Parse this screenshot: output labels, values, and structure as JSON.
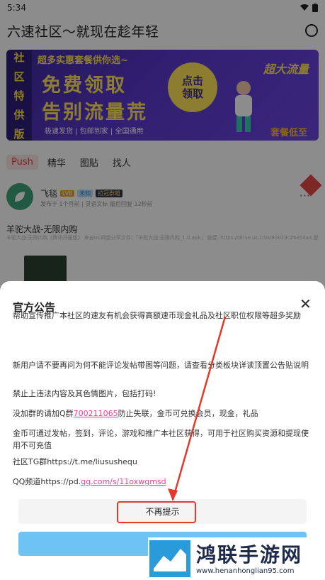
{
  "status_bar": {
    "time": "5:34"
  },
  "header": {
    "title": "六速社区～就现在趁年轻"
  },
  "banner": {
    "side_chars": [
      "社",
      "区",
      "特",
      "供",
      "版"
    ],
    "promo_line": "超多实惠套餐供你选~",
    "big_line_1": "免费领取",
    "big_line_2": "告别流量荒",
    "bottom_line": "极速发货 | 包邮到家 | 全国通用",
    "claim_line_1": "点击",
    "claim_line_2": "领取",
    "right_tag": "超大流量",
    "right_bottom": "套餐低至"
  },
  "tabs": [
    {
      "label": "Push",
      "active": true
    },
    {
      "label": "精华",
      "active": false
    },
    {
      "label": "图贴",
      "active": false
    },
    {
      "label": "找人",
      "active": false
    }
  ],
  "post": {
    "author": "飞毯",
    "level_badge": "LV8",
    "badge_2": "未知",
    "badge_3": "拉冠群雄",
    "meta": "发布于 1个月前 | 灵语文标 最后回复 12秒前",
    "title": "羊驼大战-无限内购",
    "snippet": "羊驼大战-无限内购《腾讯开服版》 来自UC网盘分享文件：「羊驼大战-无限内购_1.0.apk」 链接: https://drive.uc.cn/s/83023c26e54a4 提取码: 168FUC 网盘一上传下载不限速，网速有多快，速度就有多快。 ?"
  },
  "dialog": {
    "title": "官方公告",
    "p1": "帮助宣传推广本社区的速友有机会获得高额速币现金礼品及社区职位权限等超多奖励",
    "p2": "新用户请不要再问为何不能评论发帖带图等问题，请查看分类板块详读顶置公告贴说明",
    "p3": "禁止上违法内容及其色情图片，包括打码!",
    "p4_before": "没加群的请加Q群",
    "p4_link": "700211065",
    "p4_after": "防止失联，金币可兑换会员，现金，礼品",
    "p5": "金币可通过发帖，签到，评论，游戏和推广本社区获得，可用于社区购买资源和提现使用不可充值",
    "p6": "社区TG群https://t.me/liusushequ",
    "p7_before": "QQ频道https://pd.",
    "p7_link": "qq.com/s/11oxwgmsd",
    "no_remind": "不再提示"
  },
  "watermark": {
    "name": "鸿联手游网",
    "url": "www.henanhonglian95.com"
  },
  "colors": {
    "banner_purple": "#5a3ad0",
    "accent_yellow": "#ffe35a",
    "link_pink": "#e0409a",
    "annotation_red": "#e5372b",
    "confirm_blue": "#6ec3f5"
  }
}
